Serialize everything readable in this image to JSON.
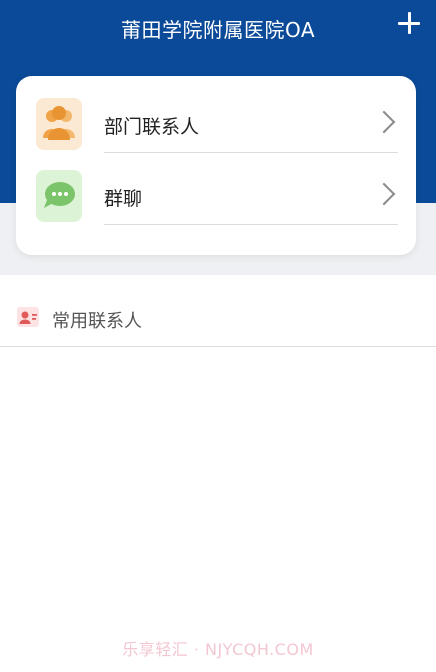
{
  "header": {
    "title": "莆田学院附属医院OA",
    "add_icon": "plus-icon"
  },
  "menu": {
    "items": [
      {
        "label": "部门联系人",
        "icon": "department-contacts-icon",
        "trailing_icon": "chevron-right-icon"
      },
      {
        "label": "群聊",
        "icon": "group-chat-icon",
        "trailing_icon": "chevron-right-icon"
      }
    ]
  },
  "frequent": {
    "label": "常用联系人",
    "icon": "contact-card-icon"
  },
  "watermark": "乐享轻汇 · NJYCQH.COM",
  "colors": {
    "header_bg": "#0b4a98",
    "people_icon": "#f0a347",
    "chat_icon": "#7bc46a",
    "contact_icon": "#e05a5a"
  }
}
